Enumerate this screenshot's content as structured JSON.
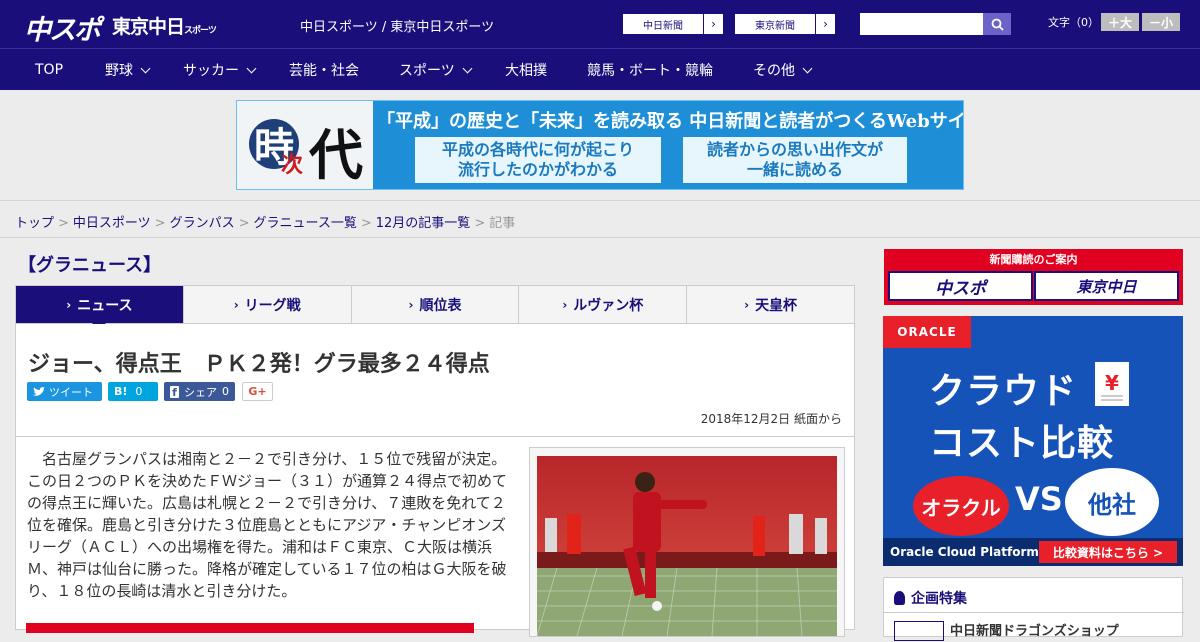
{
  "header": {
    "logo_main": "中スポ",
    "logo_tokyo": "東京中日",
    "logo_tokyo_suffix": "スポーツ",
    "site_title": "中日スポーツ / 東京中日スポーツ",
    "paper_links": [
      "中日新聞",
      "東京新聞"
    ],
    "search_placeholder": "",
    "font_size_label": "文字（0）",
    "font_bigger": "＋大",
    "font_smaller": "－小"
  },
  "nav": {
    "items": [
      {
        "label": "TOP",
        "has_menu": false
      },
      {
        "label": "野球",
        "has_menu": true
      },
      {
        "label": "サッカー",
        "has_menu": true
      },
      {
        "label": "芸能・社会",
        "has_menu": false
      },
      {
        "label": "スポーツ",
        "has_menu": true
      },
      {
        "label": "大相撲",
        "has_menu": false
      },
      {
        "label": "競馬・ボート・競輪",
        "has_menu": false
      },
      {
        "label": "その他",
        "has_menu": true
      }
    ]
  },
  "banner": {
    "kanji_1": "時",
    "kanji_2": "次",
    "kanji_3": "代",
    "headline": "「平成」の歴史と「未来」を読み取る 中日新聞と読者がつくるWebサイト",
    "box_left_l1": "平成の各時代に何が起こり",
    "box_left_l2": "流行したのかがわかる",
    "box_right_l1": "読者からの思い出作文が",
    "box_right_l2": "一緒に読める"
  },
  "breadcrumb": {
    "items": [
      "トップ",
      "中日スポーツ",
      "グランパス",
      "グラニュース一覧",
      "12月の記事一覧"
    ],
    "current": "記事",
    "separator": ">"
  },
  "category_title": "【グラニュース】",
  "tabs": [
    {
      "label": "ニュース",
      "active": true
    },
    {
      "label": "リーグ戦",
      "active": false
    },
    {
      "label": "順位表",
      "active": false
    },
    {
      "label": "ルヴァン杯",
      "active": false
    },
    {
      "label": "天皇杯",
      "active": false
    }
  ],
  "article": {
    "title": "ジョー、得点王　ＰＫ２発！グラ最多２４得点",
    "share": {
      "tweet": "ツイート",
      "hatena": "B!",
      "hatena_count": "0",
      "fb": "シェア",
      "fb_count": "0",
      "gplus": "G+"
    },
    "date": "2018年12月2日 紙面から",
    "body": "名古屋グランパスは湘南と２－２で引き分け、１５位で残留が決定。この日２つのＰＫを決めたＦＷジョー（３１）が通算２４得点で初めての得点王に輝いた。広島は札幌と２－２で引き分け、７連敗を免れて２位を確保。鹿島と引き分けた３位鹿島とともにアジア・チャンピオンズリーグ（ＡＣＬ）への出場権を得た。浦和はＦＣ東京、Ｃ大阪は横浜Ｍ、神戸は仙台に勝った。降格が確定している１７位の柏はＧ大阪を破り、１８位の長崎は清水と引き分けた。"
  },
  "sidebar": {
    "subscribe_title": "新聞購読のご案内",
    "subscribe_btn1": "中スポ",
    "subscribe_btn2": "東京中日",
    "ad": {
      "brand": "ORACLE",
      "line1": "クラウド",
      "line2": "コスト比較",
      "left_bubble": "オラクル",
      "vs": "VS",
      "right_bubble": "他社",
      "footer": "Oracle Cloud Platform",
      "cta": "比較資料はこちら >"
    },
    "features_title": "企画特集",
    "feature_item": "中日新聞ドラゴンズショップ"
  },
  "colors": {
    "brand_navy": "#1a0f7a",
    "accent_red": "#e00020",
    "twitter": "#1b95e0",
    "hatena": "#00a4de",
    "facebook": "#3b5998"
  }
}
